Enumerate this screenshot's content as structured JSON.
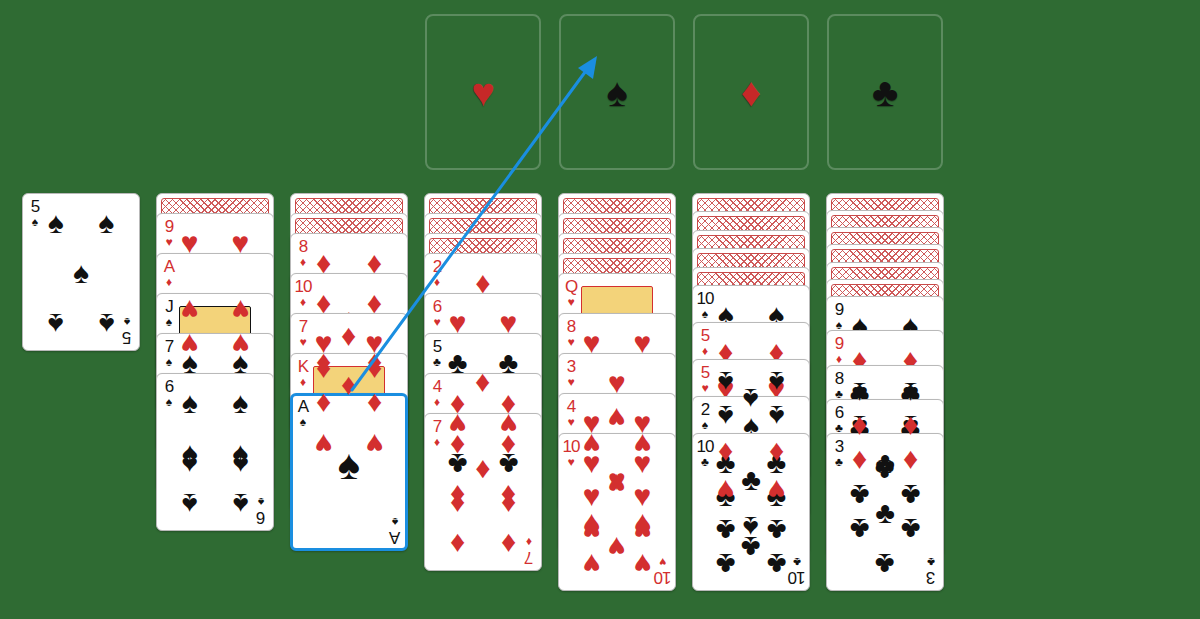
{
  "foundations": [
    {
      "suit": "♥",
      "color": "#c62828"
    },
    {
      "suit": "♠",
      "color": "#111111"
    },
    {
      "suit": "♦",
      "color": "#c62828"
    },
    {
      "suit": "♣",
      "color": "#111111"
    }
  ],
  "waste": {
    "cards": [
      {
        "face_up": true,
        "rank": "5",
        "suit": "♠",
        "color": "#111111",
        "selected": false
      }
    ]
  },
  "tableau": [
    {
      "cards": [
        {
          "face_up": false,
          "selected": false
        },
        {
          "face_up": true,
          "rank": "9",
          "suit": "♥",
          "color": "#d32f2f",
          "selected": false
        },
        {
          "face_up": true,
          "rank": "A",
          "suit": "♦",
          "color": "#d32f2f",
          "selected": false
        },
        {
          "face_up": true,
          "rank": "J",
          "suit": "♠",
          "color": "#111111",
          "selected": false
        },
        {
          "face_up": true,
          "rank": "7",
          "suit": "♠",
          "color": "#111111",
          "selected": false
        },
        {
          "face_up": true,
          "rank": "6",
          "suit": "♠",
          "color": "#111111",
          "selected": false
        }
      ]
    },
    {
      "cards": [
        {
          "face_up": false,
          "selected": false
        },
        {
          "face_up": false,
          "selected": false
        },
        {
          "face_up": true,
          "rank": "8",
          "suit": "♦",
          "color": "#d32f2f",
          "selected": false
        },
        {
          "face_up": true,
          "rank": "10",
          "suit": "♦",
          "color": "#d32f2f",
          "selected": false
        },
        {
          "face_up": true,
          "rank": "7",
          "suit": "♥",
          "color": "#d32f2f",
          "selected": false
        },
        {
          "face_up": true,
          "rank": "K",
          "suit": "♦",
          "color": "#d32f2f",
          "selected": false
        },
        {
          "face_up": true,
          "rank": "A",
          "suit": "♠",
          "color": "#111111",
          "selected": true
        }
      ]
    },
    {
      "cards": [
        {
          "face_up": false,
          "selected": false
        },
        {
          "face_up": false,
          "selected": false
        },
        {
          "face_up": false,
          "selected": false
        },
        {
          "face_up": true,
          "rank": "2",
          "suit": "♦",
          "color": "#d32f2f",
          "selected": false
        },
        {
          "face_up": true,
          "rank": "6",
          "suit": "♥",
          "color": "#d32f2f",
          "selected": false
        },
        {
          "face_up": true,
          "rank": "5",
          "suit": "♣",
          "color": "#111111",
          "selected": false
        },
        {
          "face_up": true,
          "rank": "4",
          "suit": "♦",
          "color": "#d32f2f",
          "selected": false
        },
        {
          "face_up": true,
          "rank": "7",
          "suit": "♦",
          "color": "#d32f2f",
          "selected": false
        }
      ]
    },
    {
      "cards": [
        {
          "face_up": false,
          "selected": false
        },
        {
          "face_up": false,
          "selected": false
        },
        {
          "face_up": false,
          "selected": false
        },
        {
          "face_up": false,
          "selected": false
        },
        {
          "face_up": true,
          "rank": "Q",
          "suit": "♥",
          "color": "#d32f2f",
          "selected": false
        },
        {
          "face_up": true,
          "rank": "8",
          "suit": "♥",
          "color": "#d32f2f",
          "selected": false
        },
        {
          "face_up": true,
          "rank": "3",
          "suit": "♥",
          "color": "#d32f2f",
          "selected": false
        },
        {
          "face_up": true,
          "rank": "4",
          "suit": "♥",
          "color": "#d32f2f",
          "selected": false
        },
        {
          "face_up": true,
          "rank": "10",
          "suit": "♥",
          "color": "#d32f2f",
          "selected": false
        }
      ]
    },
    {
      "cards": [
        {
          "face_up": false,
          "selected": false
        },
        {
          "face_up": false,
          "selected": false
        },
        {
          "face_up": false,
          "selected": false
        },
        {
          "face_up": false,
          "selected": false
        },
        {
          "face_up": false,
          "selected": false
        },
        {
          "face_up": true,
          "rank": "10",
          "suit": "♠",
          "color": "#111111",
          "selected": false
        },
        {
          "face_up": true,
          "rank": "5",
          "suit": "♦",
          "color": "#d32f2f",
          "selected": false
        },
        {
          "face_up": true,
          "rank": "5",
          "suit": "♥",
          "color": "#d32f2f",
          "selected": false
        },
        {
          "face_up": true,
          "rank": "2",
          "suit": "♠",
          "color": "#111111",
          "selected": false
        },
        {
          "face_up": true,
          "rank": "10",
          "suit": "♣",
          "color": "#111111",
          "selected": false
        }
      ]
    },
    {
      "cards": [
        {
          "face_up": false,
          "selected": false
        },
        {
          "face_up": false,
          "selected": false
        },
        {
          "face_up": false,
          "selected": false
        },
        {
          "face_up": false,
          "selected": false
        },
        {
          "face_up": false,
          "selected": false
        },
        {
          "face_up": false,
          "selected": false
        },
        {
          "face_up": true,
          "rank": "9",
          "suit": "♠",
          "color": "#111111",
          "selected": false
        },
        {
          "face_up": true,
          "rank": "9",
          "suit": "♦",
          "color": "#d32f2f",
          "selected": false
        },
        {
          "face_up": true,
          "rank": "8",
          "suit": "♣",
          "color": "#111111",
          "selected": false
        },
        {
          "face_up": true,
          "rank": "6",
          "suit": "♣",
          "color": "#111111",
          "selected": false
        },
        {
          "face_up": true,
          "rank": "3",
          "suit": "♣",
          "color": "#111111",
          "selected": false
        }
      ]
    }
  ],
  "hint": {
    "shown": true
  }
}
